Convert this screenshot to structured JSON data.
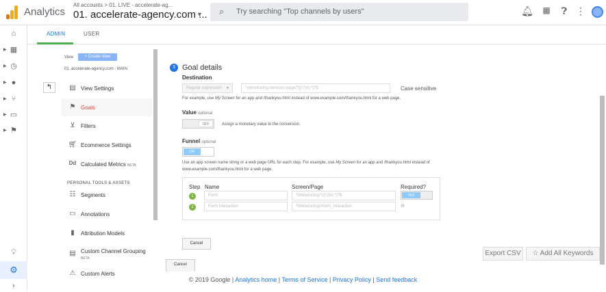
{
  "header": {
    "app_name": "Analytics",
    "breadcrumb": "All accounts > 01. LIVE - accelerate-ag...",
    "account": "01. accelerate-agency.com ...",
    "search_placeholder": "Try searching \"Top channels by users\"",
    "icons": [
      "bell-icon",
      "apps-grid-icon",
      "help-icon",
      "more-vert-icon",
      "account-avatar"
    ]
  },
  "tabs": [
    "ADMIN",
    "USER"
  ],
  "view": {
    "label": "View",
    "create_label": "+ Create View",
    "view_name": "01. accelerate-agency.com - MAIN"
  },
  "sidebar": {
    "items": [
      {
        "label": "View Settings",
        "icon": "document-icon"
      },
      {
        "label": "Goals",
        "icon": "flag-icon",
        "active": true
      },
      {
        "label": "Filters",
        "icon": "filter-icon"
      },
      {
        "label": "Ecommerce Settings",
        "icon": "cart-icon"
      },
      {
        "label": "Calculated Metrics",
        "badge": "BETA",
        "icon": "dd-icon"
      }
    ],
    "section_title": "PERSONAL TOOLS & ASSETS",
    "tools": [
      {
        "label": "Segments",
        "icon": "segments-icon"
      },
      {
        "label": "Annotations",
        "icon": "annotation-icon"
      },
      {
        "label": "Attribution Models",
        "icon": "bar-chart-icon"
      },
      {
        "label": "Custom Channel Grouping",
        "badge": "BETA",
        "icon": "channel-grouping-icon"
      },
      {
        "label": "Custom Alerts",
        "icon": "alert-icon"
      }
    ]
  },
  "goal": {
    "step_number": "3",
    "title": "Goal details",
    "destination_label": "Destination",
    "match_type": "Regular expression",
    "destination_value": "^/introducing-services-page/?((\\?|#).*)?$",
    "case_sensitive": "Case sensitive",
    "destination_help_prefix": "For example, use ",
    "destination_help_em": "My Screen",
    "destination_help_suffix": " for an app and /thankyou.html instead of www.example.com/thankyou.html for a web page.",
    "value_label": "Value",
    "value_optional": "optional",
    "value_toggle": "OFF",
    "value_help": "Assign a monetary value to the conversion.",
    "funnel_label": "Funnel",
    "funnel_optional": "optional",
    "funnel_toggle": "ON",
    "funnel_help_prefix": "Use an app screen name string or a web page URL for each step. For example, use ",
    "funnel_help_em": "My Screen",
    "funnel_help_suffix": " for an app and /thankyou.html instead of www.example.com/thankyou.html for a web page.",
    "funnel_headers": {
      "step": "Step",
      "name": "Name",
      "screen": "Screen/Page",
      "required": "Required?"
    },
    "funnel_steps": [
      {
        "num": "1",
        "name": "Form",
        "screen": "^/introducing/?((\\?|#).*)?$",
        "required": "YES"
      },
      {
        "num": "2",
        "name": "Form Interaction",
        "screen": "^/introducing/#form_interaction"
      }
    ],
    "cancel_inner": "Cancel",
    "cancel_outer": "Cancel"
  },
  "actions": {
    "export_csv": "Export CSV",
    "add_keywords": "☆ Add All Keywords"
  },
  "footer": {
    "copyright": "© 2019 Google | ",
    "links": [
      "Analytics home",
      "Terms of Service",
      "Privacy Policy",
      "Send feedback"
    ]
  },
  "colors": {
    "accent": "#1a73e8",
    "active": "#e53935",
    "step_green": "#7cb342",
    "tab_underline": "#4caf50"
  }
}
